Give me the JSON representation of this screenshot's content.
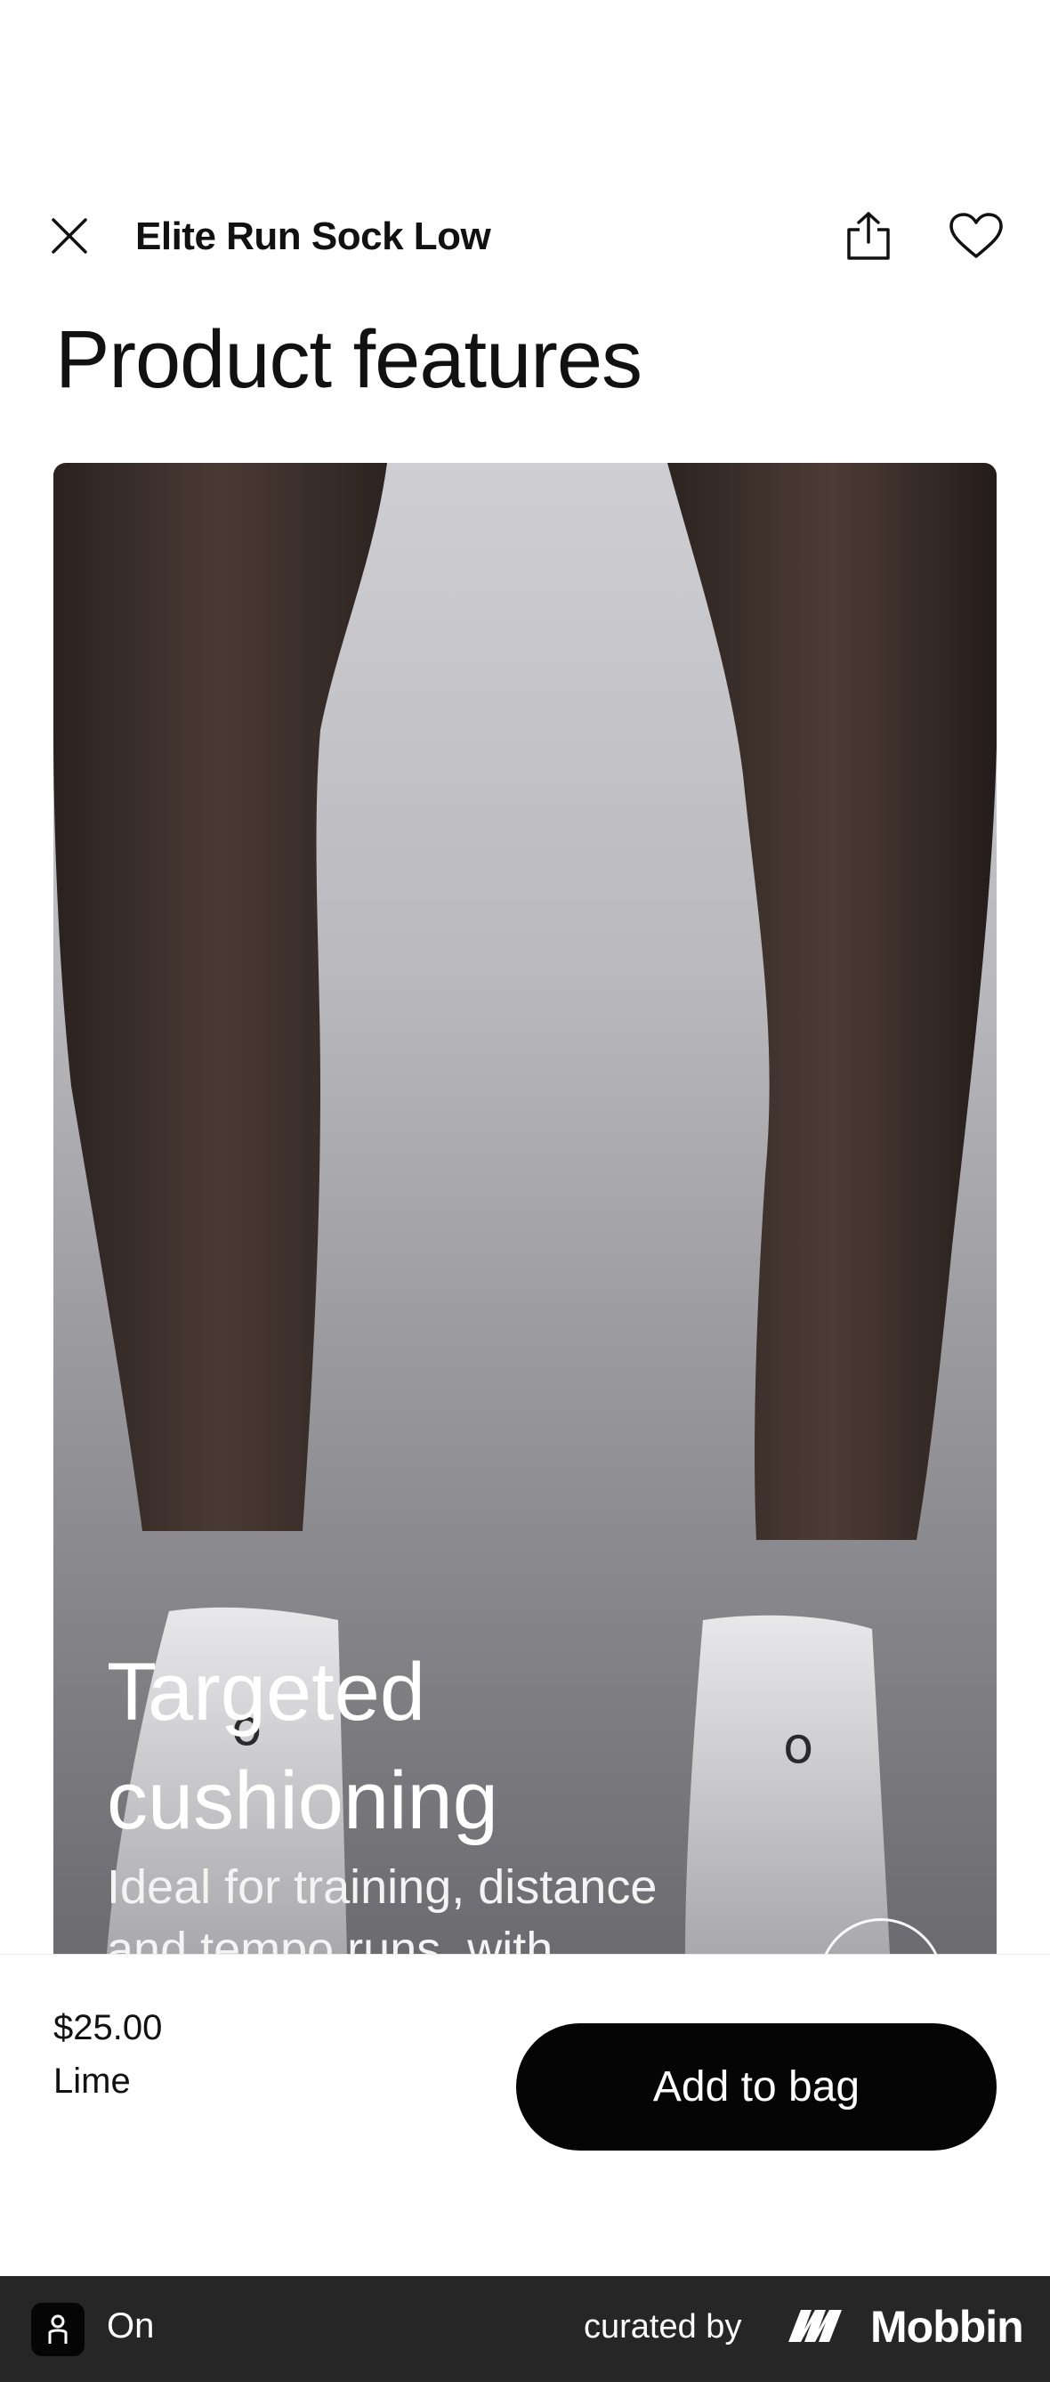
{
  "header": {
    "product_name": "Elite Run Sock Low"
  },
  "section": {
    "title": "Product features"
  },
  "feature": {
    "heading_line1": "Targeted",
    "heading_line2": "cushioning",
    "description_line1": "Ideal for training, distance",
    "description_line2": "and tempo runs, with"
  },
  "purchase": {
    "price": "$25.00",
    "color": "Lime",
    "add_label": "Add to bag"
  },
  "footer": {
    "app_name": "On",
    "curated_by": "curated by",
    "brand": "Mobbin"
  },
  "colors": {
    "button_bg": "#050505",
    "footer_bg": "#262626"
  }
}
